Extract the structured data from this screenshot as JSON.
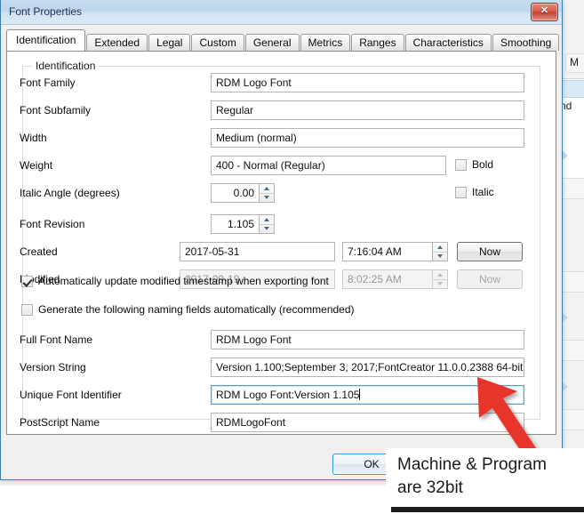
{
  "dialog": {
    "title": "Font Properties",
    "close_label": "✕",
    "ok_label": "OK"
  },
  "tabs": [
    {
      "label": "Identification",
      "active": true
    },
    {
      "label": "Extended",
      "active": false
    },
    {
      "label": "Legal",
      "active": false
    },
    {
      "label": "Custom",
      "active": false
    },
    {
      "label": "General",
      "active": false
    },
    {
      "label": "Metrics",
      "active": false
    },
    {
      "label": "Ranges",
      "active": false
    },
    {
      "label": "Characteristics",
      "active": false
    },
    {
      "label": "Smoothing",
      "active": false
    }
  ],
  "group": {
    "legend": "Identification"
  },
  "fields": {
    "font_family": {
      "label": "Font Family",
      "value": "RDM Logo Font"
    },
    "font_subfamily": {
      "label": "Font Subfamily",
      "value": "Regular"
    },
    "width": {
      "label": "Width",
      "value": "Medium (normal)"
    },
    "weight": {
      "label": "Weight",
      "value": "400 - Normal (Regular)"
    },
    "italic_angle": {
      "label": "Italic Angle (degrees)",
      "value": "0.00"
    },
    "font_revision": {
      "label": "Font Revision",
      "value": "1.105"
    },
    "created": {
      "label": "Created",
      "date": "2017-05-31",
      "time": "7:16:04 AM",
      "now_label": "Now"
    },
    "modified": {
      "label": "Modified",
      "date": "2017-09-19",
      "time": "8:02:25 AM",
      "now_label": "Now"
    },
    "full_font_name": {
      "label": "Full Font Name",
      "value": "RDM Logo Font"
    },
    "version_string": {
      "label": "Version String",
      "value": "Version 1.100;September 3, 2017;FontCreator 11.0.0.2388 64-bit"
    },
    "unique_font_identifier": {
      "label": "Unique Font Identifier",
      "value": "RDM Logo Font:Version 1.105"
    },
    "postscript_name": {
      "label": "PostScript Name",
      "value": "RDMLogoFont"
    }
  },
  "checkboxes": {
    "bold": {
      "label": "Bold",
      "checked": false
    },
    "italic": {
      "label": "Italic",
      "checked": false
    },
    "auto_update": {
      "label": "Automatically update modified timestamp when exporting font",
      "checked": true
    },
    "auto_generate": {
      "label": "Generate the following naming fields automatically (recommended)",
      "checked": false
    }
  },
  "annotation": {
    "line1": "Machine & Program",
    "line2": "are 32bit",
    "arrow_color": "#e8342a"
  },
  "background_window": {
    "fragment_m": "M",
    "fragment_nd": "nd"
  }
}
